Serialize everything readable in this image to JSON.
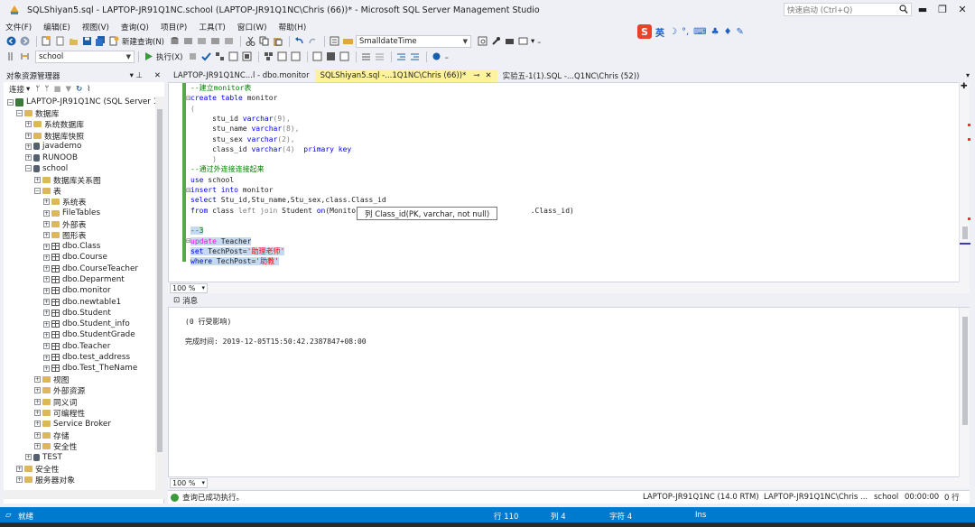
{
  "window": {
    "title": "SQLShiyan5.sql - LAPTOP-JR91Q1NC.school (LAPTOP-JR91Q1NC\\Chris (66))* - Microsoft SQL Server Management Studio",
    "quick_launch_placeholder": "快速启动 (Ctrl+Q)"
  },
  "menu": [
    "文件(F)",
    "编辑(E)",
    "视图(V)",
    "查询(Q)",
    "项目(P)",
    "工具(T)",
    "窗口(W)",
    "帮助(H)"
  ],
  "toolbar": {
    "new_query": "新建查询(N)",
    "type_combo": "SmalldateTime",
    "database_combo": "school",
    "execute": "执行(X)"
  },
  "object_explorer": {
    "title": "对象资源管理器",
    "connect": "连接",
    "nodes": [
      {
        "label": "LAPTOP-JR91Q1NC (SQL Server 14",
        "icon": "server-icon",
        "exp": "−"
      },
      {
        "label": "数据库",
        "icon": "folder-icon",
        "exp": "−"
      },
      {
        "label": "系统数据库",
        "icon": "folder-icon",
        "exp": "+"
      },
      {
        "label": "数据库快照",
        "icon": "folder-icon",
        "exp": "+"
      },
      {
        "label": "javademo",
        "icon": "database-icon",
        "exp": "+"
      },
      {
        "label": "RUNOOB",
        "icon": "database-icon",
        "exp": "+"
      },
      {
        "label": "school",
        "icon": "database-icon",
        "exp": "−"
      },
      {
        "label": "数据库关系图",
        "icon": "folder-icon",
        "exp": "+"
      },
      {
        "label": "表",
        "icon": "folder-icon",
        "exp": "−"
      },
      {
        "label": "系统表",
        "icon": "folder-icon",
        "exp": "+"
      },
      {
        "label": "FileTables",
        "icon": "folder-icon",
        "exp": "+"
      },
      {
        "label": "外部表",
        "icon": "folder-icon",
        "exp": "+"
      },
      {
        "label": "图形表",
        "icon": "folder-icon",
        "exp": "+"
      },
      {
        "label": "dbo.Class",
        "icon": "table-icon",
        "exp": "+"
      },
      {
        "label": "dbo.Course",
        "icon": "table-icon",
        "exp": "+"
      },
      {
        "label": "dbo.CourseTeacher",
        "icon": "table-icon",
        "exp": "+"
      },
      {
        "label": "dbo.Deparment",
        "icon": "table-icon",
        "exp": "+"
      },
      {
        "label": "dbo.monitor",
        "icon": "table-icon",
        "exp": "+"
      },
      {
        "label": "dbo.newtable1",
        "icon": "table-icon",
        "exp": "+"
      },
      {
        "label": "dbo.Student",
        "icon": "table-icon",
        "exp": "+"
      },
      {
        "label": "dbo.Student_info",
        "icon": "table-icon",
        "exp": "+"
      },
      {
        "label": "dbo.StudentGrade",
        "icon": "table-icon",
        "exp": "+"
      },
      {
        "label": "dbo.Teacher",
        "icon": "table-icon",
        "exp": "+"
      },
      {
        "label": "dbo.test_address",
        "icon": "table-icon",
        "exp": "+"
      },
      {
        "label": "dbo.Test_TheName",
        "icon": "table-icon",
        "exp": "+"
      },
      {
        "label": "视图",
        "icon": "folder-icon",
        "exp": "+"
      },
      {
        "label": "外部资源",
        "icon": "folder-icon",
        "exp": "+"
      },
      {
        "label": "同义词",
        "icon": "folder-icon",
        "exp": "+"
      },
      {
        "label": "可编程性",
        "icon": "folder-icon",
        "exp": "+"
      },
      {
        "label": "Service Broker",
        "icon": "folder-icon",
        "exp": "+"
      },
      {
        "label": "存储",
        "icon": "folder-icon",
        "exp": "+"
      },
      {
        "label": "安全性",
        "icon": "folder-icon",
        "exp": "+"
      },
      {
        "label": "TEST",
        "icon": "database-icon",
        "exp": "+"
      },
      {
        "label": "安全性",
        "icon": "folder-icon",
        "exp": "+"
      },
      {
        "label": "服务器对象",
        "icon": "folder-icon",
        "exp": "+"
      }
    ]
  },
  "tabs": [
    {
      "label": "LAPTOP-JR91Q1NC...l - dbo.monitor"
    },
    {
      "label": "SQLShiyan5.sql -...1Q1NC\\Chris (66))*"
    },
    {
      "label": "实验五-1(1).SQL -...Q1NC\\Chris (52))"
    }
  ],
  "code": {
    "l1": "--建立monitor表",
    "l2a": "create table",
    "l2b": " monitor",
    "l3": "(",
    "l4a": "     stu_id ",
    "l4b": "varchar",
    "l4c": "(9),",
    "l5a": "     stu_name ",
    "l5b": "varchar",
    "l5c": "(8),",
    "l6a": "     stu_sex ",
    "l6b": "varchar",
    "l6c": "(2),",
    "l7a": "     class_id ",
    "l7b": "varchar",
    "l7c": "(4)  ",
    "l7d": "primary key",
    "l8": "     )",
    "l9": "--通过外连接连接起来",
    "l10a": "use",
    "l10b": " school",
    "l11a": "insert into",
    "l11b": " monitor",
    "l12a": "select",
    "l12b": " Stu_id,Stu_name,Stu_sex,class.Class_id",
    "l13a": "from",
    "l13b": " class ",
    "l13c": "left join",
    "l13d": " Student ",
    "l13e": "on",
    "l13f": "(Monitor=",
    "l13g": ".Class_id)",
    "l14": "--3",
    "l15a": "update",
    "l15b": " Teacher",
    "l16a": "set",
    "l16b": " TechPost=",
    "l16c": "'助理老师'",
    "l17a": "where",
    "l17b": " TechPost=",
    "l17c": "'助教'"
  },
  "tooltip": "列 Class_id(PK, varchar, not null)",
  "zoom": "100 %",
  "results": {
    "tab": "消息",
    "line1": "(0 行受影响)",
    "line2": "完成时间: 2019-12-05T15:50:42.2387847+08:00"
  },
  "query_status": {
    "message": "查询已成功执行。",
    "server": "LAPTOP-JR91Q1NC (14.0 RTM)",
    "user": "LAPTOP-JR91Q1NC\\Chris ...",
    "db": "school",
    "time": "00:00:00",
    "rows": "0 行"
  },
  "statusbar": {
    "ready": "就绪",
    "row": "行 110",
    "col": "列 4",
    "ch": "字符 4",
    "mode": "Ins"
  },
  "colors": {
    "accent": "#007acc",
    "active_tab": "#fff29d",
    "selection": "#c5daf0"
  }
}
